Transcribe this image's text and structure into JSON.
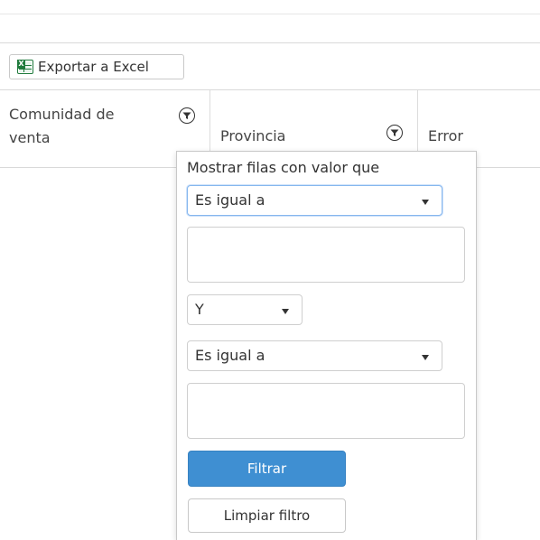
{
  "toolbar": {
    "export_label": "Exportar a Excel",
    "export_icon": "excel-icon"
  },
  "grid": {
    "columns": [
      {
        "title_line1": "Comunidad de",
        "title_line2": "venta",
        "filter_icon": "filter-icon"
      },
      {
        "title": "Provincia",
        "filter_icon": "filter-icon"
      },
      {
        "title": "Error"
      }
    ]
  },
  "filter_menu": {
    "label": "Mostrar filas con valor que",
    "operator1": "Es igual a",
    "value1": "",
    "logic": "Y",
    "operator2": "Es igual a",
    "value2": "",
    "filter_button": "Filtrar",
    "clear_button": "Limpiar filtro"
  },
  "colors": {
    "primary": "#3f8fd2",
    "border": "#cfcfcf",
    "focus": "#86b7ee"
  }
}
